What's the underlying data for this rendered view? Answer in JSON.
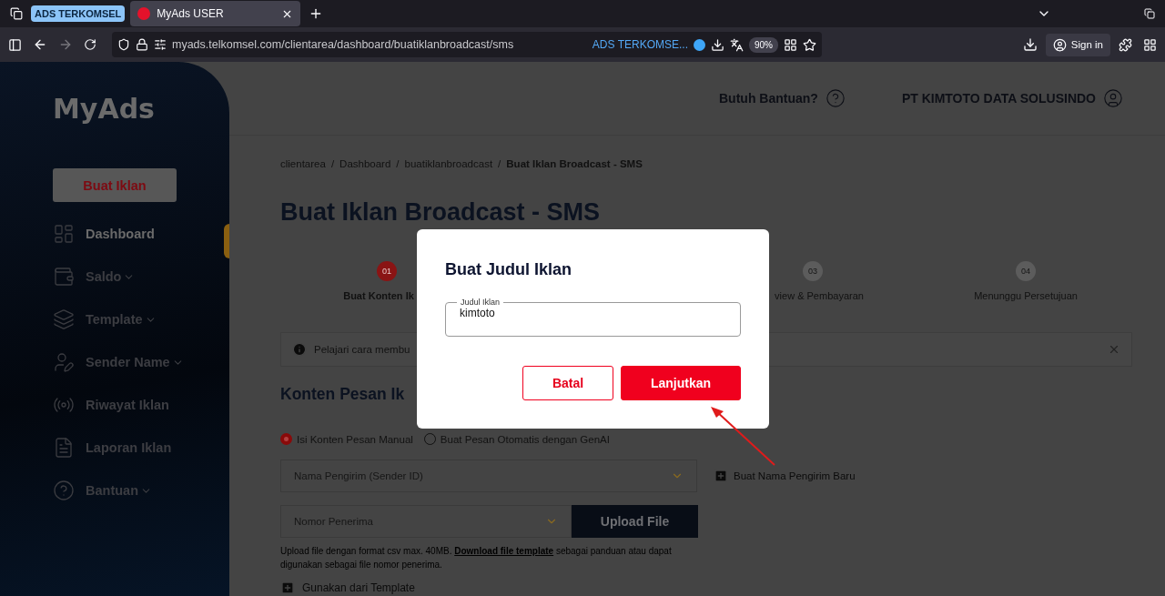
{
  "browser": {
    "tab_group": "ADS TERKOMSEL",
    "tabs": [
      {
        "title": "MyAds USER",
        "selected": true
      }
    ],
    "url": "myads.telkomsel.com/clientarea/dashboard/buatiklanbroadcast/sms",
    "container_label": "ADS TERKOMSE...",
    "zoom": "90%",
    "sign_in": "Sign in"
  },
  "sidebar": {
    "logo": "MyAds",
    "create_button": "Buat Iklan",
    "items": [
      {
        "label": "Dashboard",
        "selected": true,
        "expandable": false
      },
      {
        "label": "Saldo",
        "selected": false,
        "expandable": true
      },
      {
        "label": "Template",
        "selected": false,
        "expandable": true
      },
      {
        "label": "Sender Name",
        "selected": false,
        "expandable": true
      },
      {
        "label": "Riwayat Iklan",
        "selected": false,
        "expandable": false
      },
      {
        "label": "Laporan Iklan",
        "selected": false,
        "expandable": false
      },
      {
        "label": "Bantuan",
        "selected": false,
        "expandable": true
      }
    ]
  },
  "header": {
    "help": "Butuh Bantuan?",
    "account": "PT KIMTOTO DATA SOLUSINDO"
  },
  "breadcrumb": [
    {
      "label": "clientarea",
      "current": false
    },
    {
      "separator": "/",
      "label": "Dashboard",
      "current": false
    },
    {
      "separator": "/",
      "label": "buatiklanbroadcast",
      "current": false
    },
    {
      "separator": "/",
      "label": "Buat Iklan Broadcast - SMS",
      "current": true
    }
  ],
  "page_title": "Buat Iklan Broadcast - SMS",
  "steps": [
    {
      "number": "01",
      "label": "Buat Konten Ik",
      "selected": true
    },
    {
      "number": "03",
      "label": "view & Pembayaran",
      "selected": false
    },
    {
      "number": "04",
      "label": "Menunggu Persetujuan",
      "selected": false
    }
  ],
  "info_bar": {
    "text": "Pelajari cara membu"
  },
  "section_title": "Konten Pesan Ik",
  "content_options": [
    {
      "label": "Isi Konten Pesan Manual",
      "selected": true
    },
    {
      "label": "Buat Pesan Otomatis dengan GenAI",
      "selected": false
    }
  ],
  "sender_field": {
    "placeholder": "Nama Pengirim (Sender ID)"
  },
  "new_sender_link": "Buat Nama Pengirim Baru",
  "recipient_field": {
    "placeholder": "Nomor Penerima"
  },
  "upload_button": "Upload File",
  "upload_help": {
    "before": "Upload file dengan format csv max. 40MB.",
    "link": "Download file template",
    "after": "sebagai panduan atau dapat digunakan sebagai file nomor penerima."
  },
  "template_link": "Gunakan dari Template",
  "modal": {
    "title": "Buat Judul Iklan",
    "field_label": "Judul Iklan",
    "field_value": "kimtoto",
    "cancel": "Batal",
    "confirm": "Lanjutkan"
  }
}
